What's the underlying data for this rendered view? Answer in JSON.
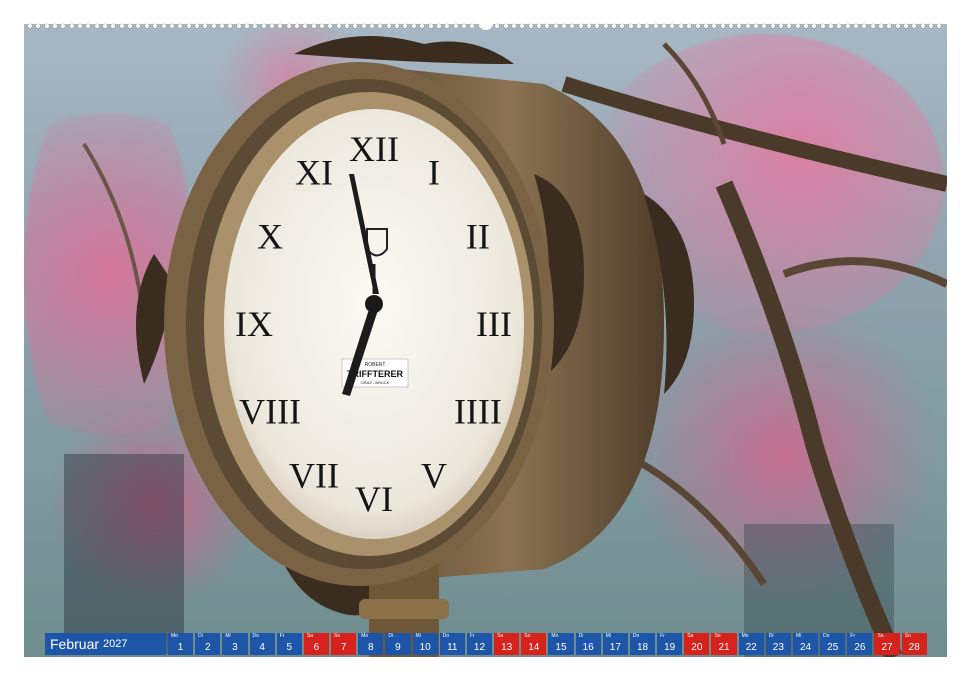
{
  "calendar": {
    "month": "Februar",
    "year": "2027",
    "days": [
      {
        "wd": "Mo",
        "num": "1",
        "weekend": false
      },
      {
        "wd": "Di",
        "num": "2",
        "weekend": false
      },
      {
        "wd": "Mi",
        "num": "3",
        "weekend": false
      },
      {
        "wd": "Do",
        "num": "4",
        "weekend": false
      },
      {
        "wd": "Fr",
        "num": "5",
        "weekend": false
      },
      {
        "wd": "Sa",
        "num": "6",
        "weekend": true
      },
      {
        "wd": "So",
        "num": "7",
        "weekend": true
      },
      {
        "wd": "Mo",
        "num": "8",
        "weekend": false
      },
      {
        "wd": "Di",
        "num": "9",
        "weekend": false
      },
      {
        "wd": "Mi",
        "num": "10",
        "weekend": false
      },
      {
        "wd": "Do",
        "num": "11",
        "weekend": false
      },
      {
        "wd": "Fr",
        "num": "12",
        "weekend": false
      },
      {
        "wd": "Sa",
        "num": "13",
        "weekend": true
      },
      {
        "wd": "So",
        "num": "14",
        "weekend": true
      },
      {
        "wd": "Mo",
        "num": "15",
        "weekend": false
      },
      {
        "wd": "Di",
        "num": "16",
        "weekend": false
      },
      {
        "wd": "Mi",
        "num": "17",
        "weekend": false
      },
      {
        "wd": "Do",
        "num": "18",
        "weekend": false
      },
      {
        "wd": "Fr",
        "num": "19",
        "weekend": false
      },
      {
        "wd": "Sa",
        "num": "20",
        "weekend": true
      },
      {
        "wd": "So",
        "num": "21",
        "weekend": true
      },
      {
        "wd": "Mo",
        "num": "22",
        "weekend": false
      },
      {
        "wd": "Di",
        "num": "23",
        "weekend": false
      },
      {
        "wd": "Mi",
        "num": "24",
        "weekend": false
      },
      {
        "wd": "Do",
        "num": "25",
        "weekend": false
      },
      {
        "wd": "Fr",
        "num": "26",
        "weekend": false
      },
      {
        "wd": "Sa",
        "num": "27",
        "weekend": true
      },
      {
        "wd": "So",
        "num": "28",
        "weekend": true
      }
    ]
  },
  "clock": {
    "brand_line1": "ROBERT",
    "brand_line2": "TRIFFTERER",
    "brand_line3": "GRAZ - BRUCK",
    "numerals": [
      "XII",
      "I",
      "II",
      "III",
      "IIII",
      "V",
      "VI",
      "VII",
      "VIII",
      "IX",
      "X",
      "XI"
    ]
  },
  "colors": {
    "calendar_blue": "#1d56a8",
    "weekend_red": "#d6221a",
    "clock_bronze": "#7a6345",
    "blossom_pink": "#e07a9a"
  }
}
